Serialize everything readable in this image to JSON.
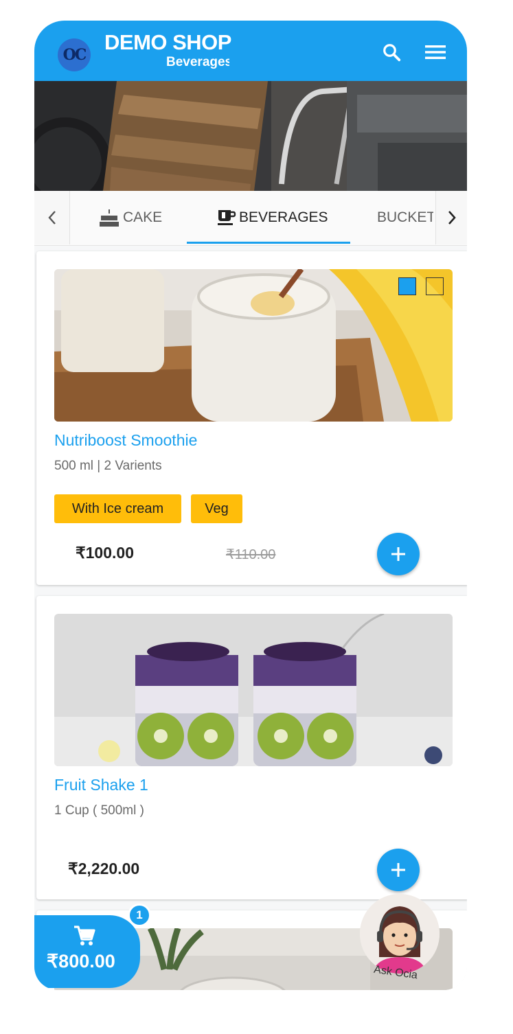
{
  "header": {
    "logo_text": "OC",
    "title": "DEMO SHOP",
    "subtitle": "Beverages",
    "search_icon": "search-icon",
    "menu_icon": "menu-icon"
  },
  "colors": {
    "brand": "#1ba0ee",
    "tag": "#ffbd0a",
    "background": "#f6f7f8"
  },
  "tabs": {
    "items": [
      {
        "label": "CAKE",
        "icon": "cake-icon"
      },
      {
        "label": "BEVERAGES",
        "icon": "coffee-cup-icon",
        "active": true
      },
      {
        "label": "BUCKET"
      }
    ]
  },
  "products": [
    {
      "name": "Nutriboost Smoothie",
      "description": "500 ml | 2 Varients",
      "tags": [
        "With Ice cream",
        "Veg"
      ],
      "price": "₹100.00",
      "old_price": "₹110.00",
      "selected_swatch": 1
    },
    {
      "name": "Fruit Shake 1",
      "description": "1 Cup ( 500ml )",
      "price": "₹2,220.00"
    }
  ],
  "cart": {
    "amount": "₹800.00",
    "count": "1",
    "icon": "cart-icon"
  },
  "assistant": {
    "label": "Ask Ocia"
  }
}
